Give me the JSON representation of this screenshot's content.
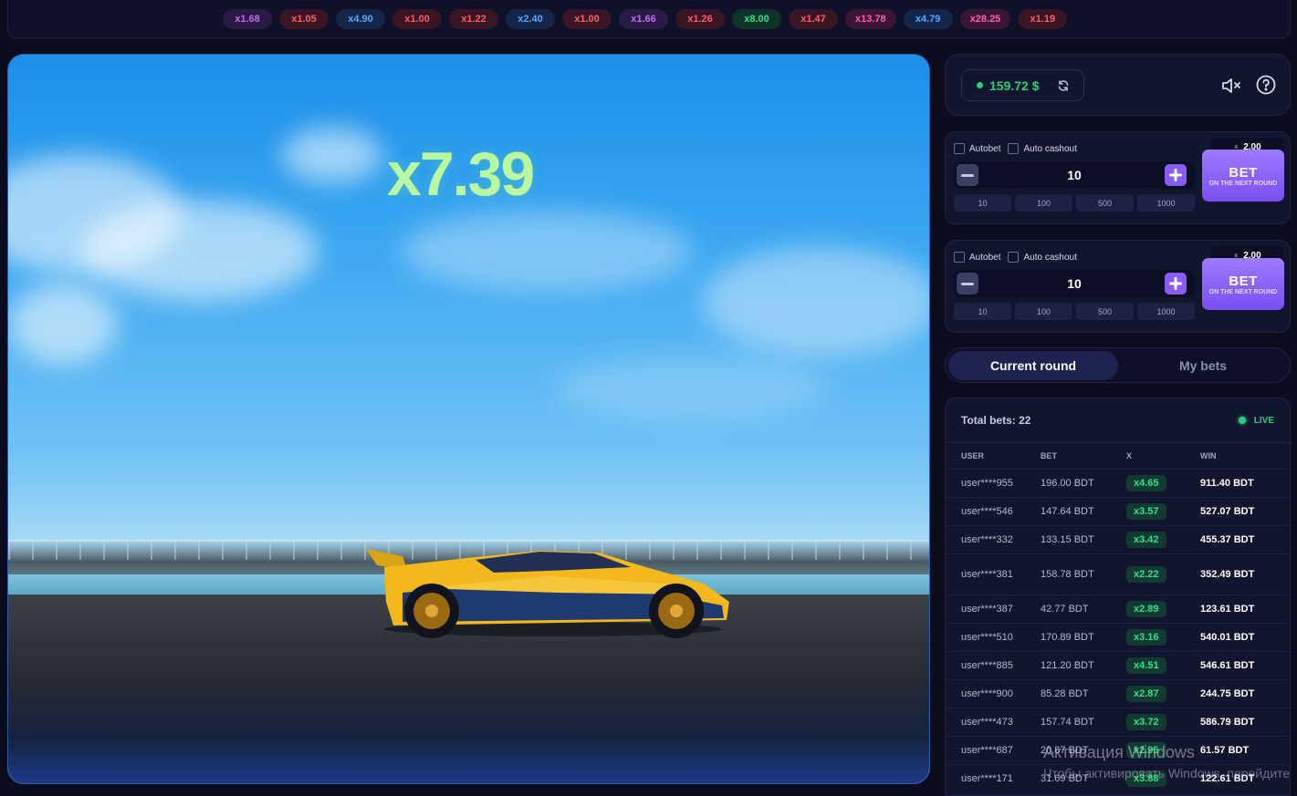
{
  "history": [
    {
      "value": "x1.68",
      "color": "#c56cf0",
      "bg": "#2a1b46"
    },
    {
      "value": "x1.05",
      "color": "#ff5d6c",
      "bg": "#3a1524"
    },
    {
      "value": "x4.90",
      "color": "#57a8ff",
      "bg": "#14264a"
    },
    {
      "value": "x1.00",
      "color": "#ff5d6c",
      "bg": "#3a1524"
    },
    {
      "value": "x1.22",
      "color": "#ff5d6c",
      "bg": "#3a1524"
    },
    {
      "value": "x2.40",
      "color": "#57a8ff",
      "bg": "#14264a"
    },
    {
      "value": "x1.00",
      "color": "#ff5d6c",
      "bg": "#3a1524"
    },
    {
      "value": "x1.66",
      "color": "#c56cf0",
      "bg": "#2a1b46"
    },
    {
      "value": "x1.26",
      "color": "#ff5d6c",
      "bg": "#3a1524"
    },
    {
      "value": "x8.00",
      "color": "#2de08a",
      "bg": "#0f3328"
    },
    {
      "value": "x1.47",
      "color": "#ff5d6c",
      "bg": "#3a1524"
    },
    {
      "value": "x13.78",
      "color": "#ff5db0",
      "bg": "#3a1534"
    },
    {
      "value": "x4.79",
      "color": "#57a8ff",
      "bg": "#14264a"
    },
    {
      "value": "x28.25",
      "color": "#ff5db0",
      "bg": "#3a1534"
    },
    {
      "value": "x1.19",
      "color": "#ff5d6c",
      "bg": "#3a1524"
    }
  ],
  "game": {
    "multiplier": "x7.39"
  },
  "balance": {
    "value": "159.72 $"
  },
  "bet_panels": [
    {
      "autobet_label": "Autobet",
      "autocashout_label": "Auto cashout",
      "autocashout_prefix": "x",
      "autocashout_value": "2,00",
      "amount": "10",
      "quick": [
        "10",
        "100",
        "500",
        "1000"
      ],
      "bet_label": "BET",
      "bet_sub": "ON THE NEXT ROUND"
    },
    {
      "autobet_label": "Autobet",
      "autocashout_label": "Auto cashout",
      "autocashout_prefix": "x",
      "autocashout_value": "2,00",
      "amount": "10",
      "quick": [
        "10",
        "100",
        "500",
        "1000"
      ],
      "bet_label": "BET",
      "bet_sub": "ON THE NEXT ROUND"
    }
  ],
  "tabs": {
    "current": "Current round",
    "mine": "My bets"
  },
  "bets": {
    "total": "Total bets: 22",
    "live": "LIVE",
    "columns": {
      "user": "USER",
      "bet": "BET",
      "x": "X",
      "win": "WIN"
    },
    "rows": [
      {
        "user": "user****955",
        "bet": "196.00 BDT",
        "x": "x4.65",
        "win": "911.40 BDT"
      },
      {
        "user": "user****546",
        "bet": "147.64 BDT",
        "x": "x3.57",
        "win": "527.07 BDT"
      },
      {
        "user": "user****332",
        "bet": "133.15 BDT",
        "x": "x3.42",
        "win": "455.37 BDT"
      },
      {
        "user": "user****381",
        "bet": "158.78 BDT",
        "x": "x2.22",
        "win": "352.49 BDT"
      },
      {
        "user": "user****387",
        "bet": "42.77 BDT",
        "x": "x2.89",
        "win": "123.61 BDT"
      },
      {
        "user": "user****510",
        "bet": "170.89 BDT",
        "x": "x3.16",
        "win": "540.01 BDT"
      },
      {
        "user": "user****885",
        "bet": "121.20 BDT",
        "x": "x4.51",
        "win": "546.61 BDT"
      },
      {
        "user": "user****900",
        "bet": "85.28 BDT",
        "x": "x2.87",
        "win": "244.75 BDT"
      },
      {
        "user": "user****473",
        "bet": "157.74 BDT",
        "x": "x3.72",
        "win": "586.79 BDT"
      },
      {
        "user": "user****687",
        "bet": "20.87 BDT",
        "x": "x2.95",
        "win": "61.57 BDT"
      },
      {
        "user": "user****171",
        "bet": "31.69 BDT",
        "x": "x3.88",
        "win": "122.61 BDT"
      }
    ]
  },
  "os_watermark": {
    "line1": "Активация Windows",
    "line2": "Чтобы активировать Windows, перейдите"
  }
}
